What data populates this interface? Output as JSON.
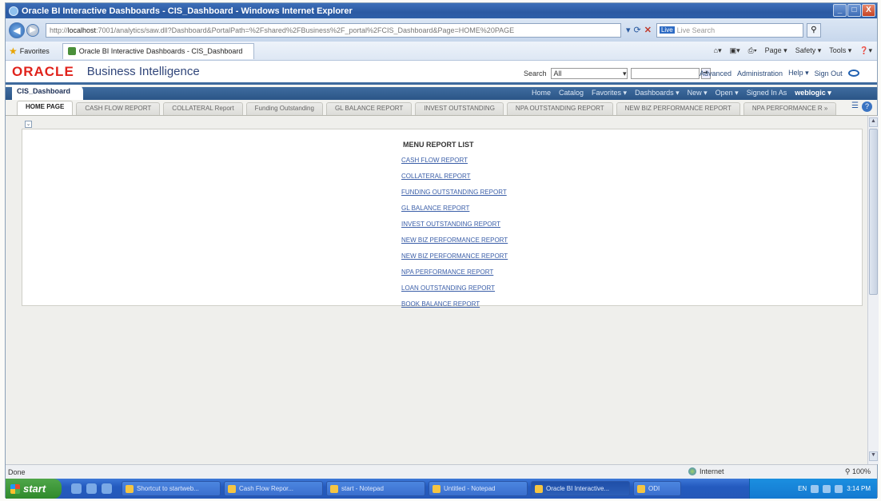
{
  "window": {
    "title": "Oracle BI Interactive Dashboards - CIS_Dashboard - Windows Internet Explorer",
    "minimize": "_",
    "maximize": "□",
    "close": "X"
  },
  "browser": {
    "address_prefix": "http://",
    "address_host": "localhost",
    "address_rest": ":7001/analytics/saw.dll?Dashboard&PortalPath=%2Fshared%2FBusiness%2F_portal%2FCIS_Dashboard&Page=HOME%20PAGE",
    "search_placeholder": "Live Search",
    "search_logo": "Live",
    "favorites_label": "Favorites",
    "tab_title": "Oracle BI Interactive Dashboards - CIS_Dashboard",
    "commands": [
      "Page ▾",
      "Safety ▾",
      "Tools ▾"
    ]
  },
  "obi": {
    "brand": "ORACLE",
    "product": "Business Intelligence",
    "search_label": "Search",
    "search_scope": "All",
    "links": [
      "Advanced",
      "Administration",
      "Help ▾",
      "Sign Out"
    ],
    "dashboard_name": "CIS_Dashboard",
    "menu": [
      "Home",
      "Catalog",
      "Favorites ▾",
      "Dashboards ▾",
      "New ▾",
      "Open ▾",
      "Signed In As"
    ],
    "user": "weblogic ▾"
  },
  "page_tabs": [
    "HOME PAGE",
    "CASH FLOW REPORT",
    "COLLATERAL Report",
    "Funding Outstanding",
    "GL BALANCE REPORT",
    "INVEST OUTSTANDING",
    "NPA OUTSTANDING REPORT",
    "NEW BIZ PERFORMANCE REPORT",
    "NPA PERFORMANCE R »"
  ],
  "content": {
    "menu_title": "MENU REPORT LIST",
    "reports": [
      "CASH FLOW REPORT",
      "COLLATERAL REPORT",
      "FUNDING OUTSTANDING REPORT",
      "GL BALANCE REPORT",
      "INVEST OUTSTANDING REPORT",
      "NEW BIZ PERFORMANCE REPORT",
      "NEW BIZ PERFORMANCE REPORT",
      "NPA PERFORMANCE REPORT",
      "LOAN OUTSTANDING REPORT",
      "BOOK BALANCE REPORT"
    ]
  },
  "status": {
    "left": "Done",
    "zone": "Internet",
    "zoom": "100%"
  },
  "taskbar": {
    "start": "start",
    "tasks": [
      "Shortcut to startweb...",
      "Cash Flow Repor...",
      "start - Notepad",
      "Untitled - Notepad",
      "Oracle BI Interactive...",
      "ODI"
    ],
    "lang": "EN",
    "clock": "3:14 PM"
  }
}
